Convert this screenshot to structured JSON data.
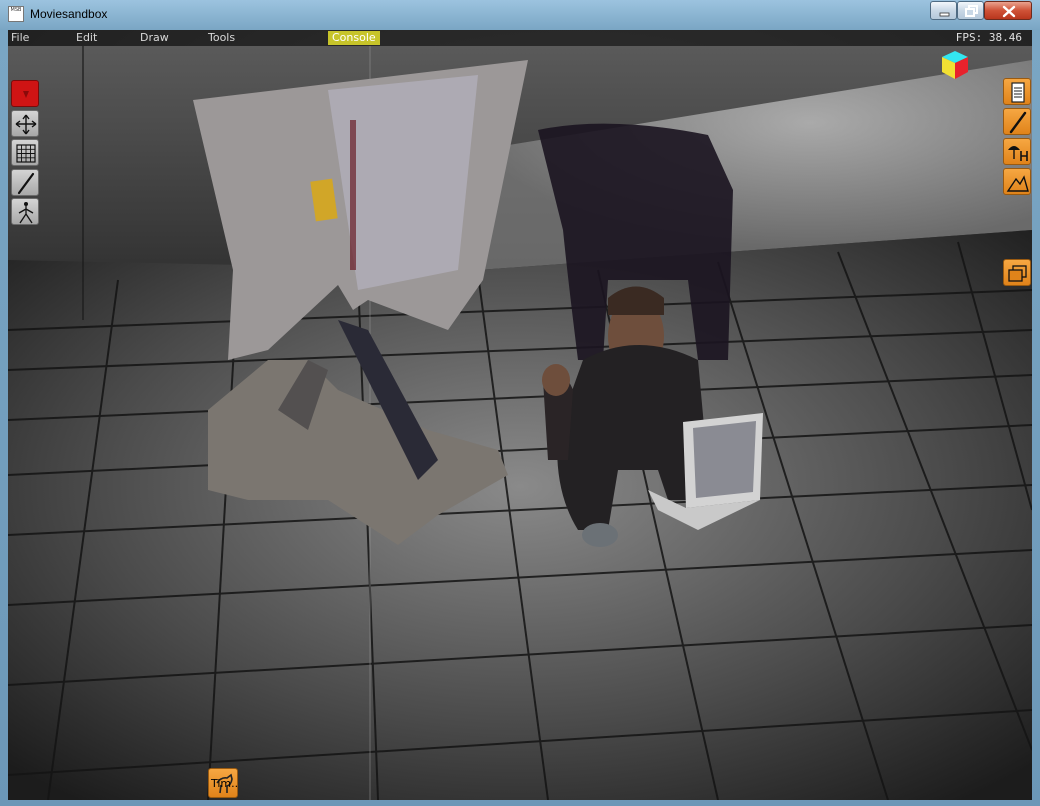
{
  "window": {
    "title": "Moviesandbox",
    "icon_text": "MSB"
  },
  "menu": {
    "items": [
      "File",
      "Edit",
      "Draw",
      "Tools",
      "Console"
    ],
    "fps": "FPS: 38.46"
  },
  "left_tools": [
    {
      "name": "select-tool",
      "icon": "red-square-icon"
    },
    {
      "name": "move-tool",
      "icon": "move-arrows-icon"
    },
    {
      "name": "grid-tool",
      "icon": "grid-icon"
    },
    {
      "name": "brush-tool",
      "icon": "brush-icon"
    },
    {
      "name": "skeleton-tool",
      "icon": "skeleton-icon"
    }
  ],
  "right_tools": [
    {
      "name": "notes-tool",
      "icon": "notepad-icon"
    },
    {
      "name": "draw-tool",
      "icon": "pen-icon"
    },
    {
      "name": "actor-tool",
      "icon": "umbrella-actor-icon"
    },
    {
      "name": "shape-tool",
      "icon": "landscape-icon"
    },
    {
      "name": "layers-tool",
      "icon": "windows-icon"
    }
  ],
  "timeline": {
    "label": "Tim.."
  },
  "colors": {
    "console_highlight": "#c7c42a",
    "tool_orange": "#e0831a",
    "tool_red": "#cf1414"
  }
}
